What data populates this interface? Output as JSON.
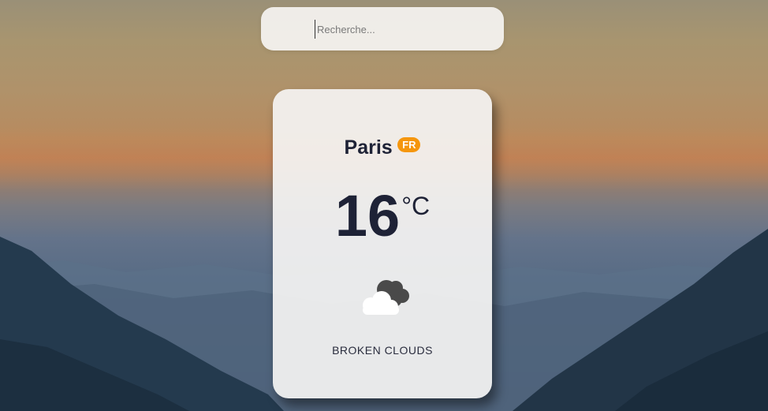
{
  "search": {
    "placeholder": "Recherche..."
  },
  "weather": {
    "city": "Paris",
    "country_code": "FR",
    "temperature": "16",
    "unit": "°C",
    "icon": "broken-clouds-icon",
    "description": "BROKEN CLOUDS"
  },
  "colors": {
    "badge": "#f5960d",
    "text_dark": "#1e2236",
    "card_bg": "#f4f3f2"
  }
}
